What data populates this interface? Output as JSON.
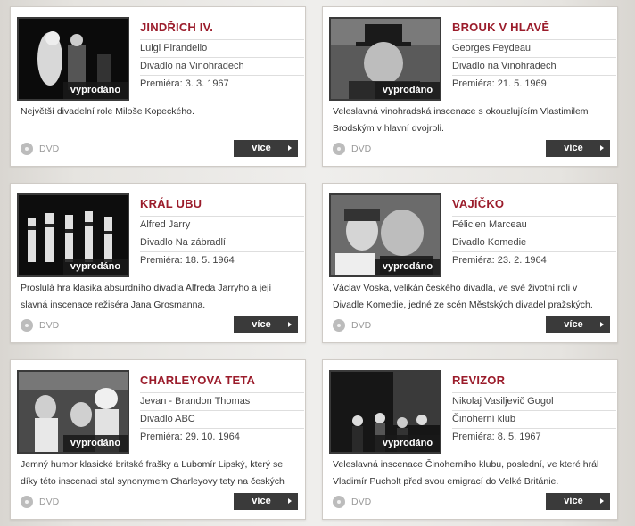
{
  "sold_badge": "vyprodáno",
  "dvd_label": "DVD",
  "more_label": "více",
  "colors": {
    "title": "#9b1c2b",
    "button": "#3a3a3a"
  },
  "cards": [
    {
      "title": "JINDŘICH IV.",
      "author": "Luigi Pirandello",
      "theatre": "Divadlo na Vinohradech",
      "premiere": "Premiéra: 3. 3. 1967",
      "description": "Největší divadelní role Miloše Kopeckého."
    },
    {
      "title": "BROUK V HLAVĚ",
      "author": "Georges Feydeau",
      "theatre": "Divadlo na Vinohradech",
      "premiere": "Premiéra: 21. 5. 1969",
      "description": "Veleslavná vinohradská inscenace s okouzlujícím Vlastimilem Brodským v hlavní dvojroli."
    },
    {
      "title": "KRÁL UBU",
      "author": "Alfred Jarry",
      "theatre": "Divadlo Na zábradlí",
      "premiere": "Premiéra: 18. 5. 1964",
      "description": "Proslulá hra klasika absurdního divadla Alfreda Jarryho a její slavná inscenace režiséra Jana Grosmanna."
    },
    {
      "title": "VAJÍČKO",
      "author": "Félicien Marceau",
      "theatre": "Divadlo Komedie",
      "premiere": "Premiéra: 23. 2. 1964",
      "description": "Václav Voska, velikán českého divadla, ve své životní roli v Divadle Komedie, jedné ze scén Městských divadel pražských."
    },
    {
      "title": "CHARLEYOVA TETA",
      "author": "Jevan - Brandon Thomas",
      "theatre": "Divadlo ABC",
      "premiere": "Premiéra: 29. 10. 1964",
      "description": "Jemný humor klasické britské frašky a Lubomír Lipský, který se díky této inscenaci stal synonymem Charleyovy tety na českých"
    },
    {
      "title": "REVIZOR",
      "author": "Nikolaj Vasiljevič Gogol",
      "theatre": "Činoherní klub",
      "premiere": "Premiéra: 8. 5. 1967",
      "description": "Veleslavná inscenace Činoherního klubu, poslední, ve které hrál Vladimír Pucholt před svou emigrací do Velké Británie."
    }
  ]
}
